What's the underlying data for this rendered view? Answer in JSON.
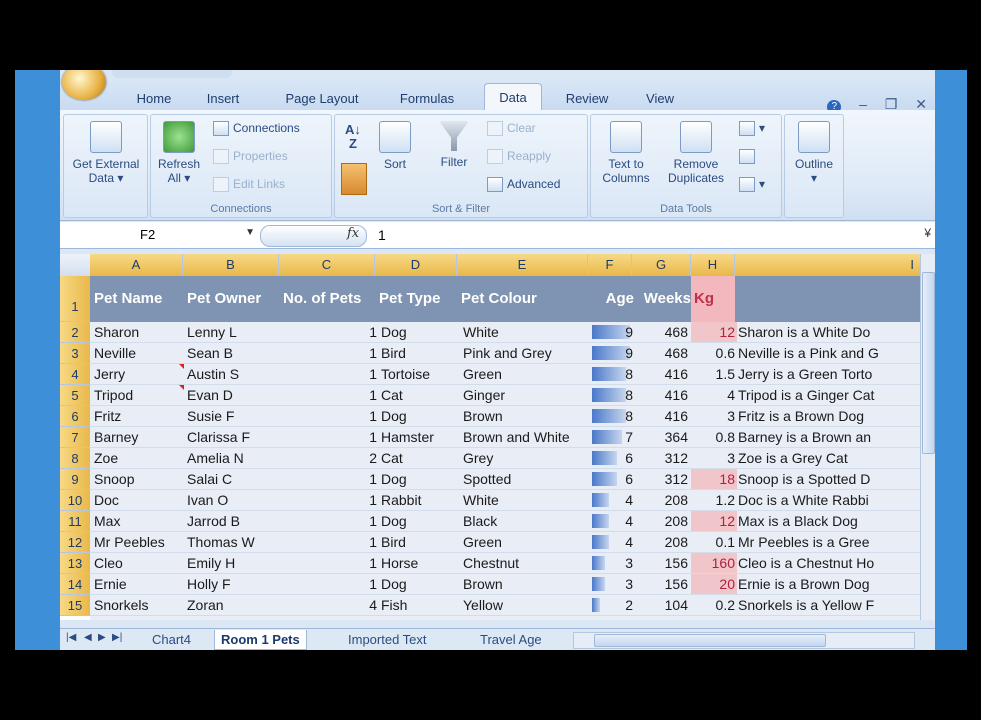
{
  "ribbon": {
    "tabs": [
      "Home",
      "Insert",
      "Page Layout",
      "Formulas",
      "Data",
      "Review",
      "View"
    ],
    "active_tab": "Data",
    "get_external_data": {
      "line1": "Get External",
      "line2": "Data ▾"
    },
    "refresh_all": {
      "line1": "Refresh",
      "line2": "All ▾"
    },
    "connections": "Connections",
    "properties": "Properties",
    "edit_links": "Edit Links",
    "connections_group": "Connections",
    "sort": "Sort",
    "filter": "Filter",
    "clear": "Clear",
    "reapply": "Reapply",
    "advanced": "Advanced",
    "sort_filter_group": "Sort & Filter",
    "text_to_columns": {
      "line1": "Text to",
      "line2": "Columns"
    },
    "remove_duplicates": {
      "line1": "Remove",
      "line2": "Duplicates"
    },
    "data_tools_group": "Data Tools",
    "outline": "Outline"
  },
  "formula_bar": {
    "name_box": "F2",
    "fx": "fx",
    "value": "1"
  },
  "columns": [
    "A",
    "B",
    "C",
    "D",
    "E",
    "F",
    "G",
    "H",
    "I"
  ],
  "headers": {
    "pet_name": "Pet Name",
    "pet_owner": "Pet Owner",
    "num_pets": "No. of Pets",
    "pet_type": "Pet Type",
    "pet_colour": "Pet Colour",
    "age": "Age",
    "weeks": "Weeks",
    "kg": "Kg"
  },
  "rows": [
    {
      "row": "2",
      "name": "Sharon",
      "owner": "Lenny L",
      "num": "1",
      "type": "Dog",
      "colour": "White",
      "age": "9",
      "weeks": "468",
      "kg": "12",
      "desc": "Sharon is a White Do",
      "hi": true
    },
    {
      "row": "3",
      "name": "Neville",
      "owner": "Sean B",
      "num": "1",
      "type": "Bird",
      "colour": "Pink and Grey",
      "age": "9",
      "weeks": "468",
      "kg": "0.6",
      "desc": "Neville is a Pink and G",
      "hi": false
    },
    {
      "row": "4",
      "name": "Jerry",
      "owner": "Austin S",
      "num": "1",
      "type": "Tortoise",
      "colour": "Green",
      "age": "8",
      "weeks": "416",
      "kg": "1.5",
      "desc": "Jerry is a Green Torto",
      "hi": false
    },
    {
      "row": "5",
      "name": "Tripod",
      "owner": "Evan D",
      "num": "1",
      "type": "Cat",
      "colour": "Ginger",
      "age": "8",
      "weeks": "416",
      "kg": "4",
      "desc": "Tripod is a Ginger Cat",
      "hi": false
    },
    {
      "row": "6",
      "name": "Fritz",
      "owner": "Susie F",
      "num": "1",
      "type": "Dog",
      "colour": "Brown",
      "age": "8",
      "weeks": "416",
      "kg": "3",
      "desc": "Fritz is a Brown Dog",
      "hi": false
    },
    {
      "row": "7",
      "name": "Barney",
      "owner": "Clarissa F",
      "num": "1",
      "type": "Hamster",
      "colour": "Brown and White",
      "age": "7",
      "weeks": "364",
      "kg": "0.8",
      "desc": "Barney is a Brown an",
      "hi": false
    },
    {
      "row": "8",
      "name": "Zoe",
      "owner": "Amelia N",
      "num": "2",
      "type": "Cat",
      "colour": "Grey",
      "age": "6",
      "weeks": "312",
      "kg": "3",
      "desc": "Zoe is a Grey Cat",
      "hi": false
    },
    {
      "row": "9",
      "name": "Snoop",
      "owner": "Salai C",
      "num": "1",
      "type": "Dog",
      "colour": "Spotted",
      "age": "6",
      "weeks": "312",
      "kg": "18",
      "desc": "Snoop is a Spotted D",
      "hi": true
    },
    {
      "row": "10",
      "name": "Doc",
      "owner": "Ivan O",
      "num": "1",
      "type": "Rabbit",
      "colour": "White",
      "age": "4",
      "weeks": "208",
      "kg": "1.2",
      "desc": "Doc is a White Rabbi",
      "hi": false
    },
    {
      "row": "11",
      "name": "Max",
      "owner": "Jarrod B",
      "num": "1",
      "type": "Dog",
      "colour": "Black",
      "age": "4",
      "weeks": "208",
      "kg": "12",
      "desc": "Max is a Black Dog",
      "hi": true
    },
    {
      "row": "12",
      "name": "Mr Peebles",
      "owner": "Thomas W",
      "num": "1",
      "type": "Bird",
      "colour": "Green",
      "age": "4",
      "weeks": "208",
      "kg": "0.1",
      "desc": "Mr Peebles is a Gree",
      "hi": false
    },
    {
      "row": "13",
      "name": "Cleo",
      "owner": "Emily H",
      "num": "1",
      "type": "Horse",
      "colour": "Chestnut",
      "age": "3",
      "weeks": "156",
      "kg": "160",
      "desc": "Cleo is a Chestnut Ho",
      "hi": true
    },
    {
      "row": "14",
      "name": "Ernie",
      "owner": "Holly F",
      "num": "1",
      "type": "Dog",
      "colour": "Brown",
      "age": "3",
      "weeks": "156",
      "kg": "20",
      "desc": "Ernie is a Brown Dog",
      "hi": true
    },
    {
      "row": "15",
      "name": "Snorkels",
      "owner": "Zoran",
      "num": "4",
      "type": "Fish",
      "colour": "Yellow",
      "age": "2",
      "weeks": "104",
      "kg": "0.2",
      "desc": "Snorkels is a Yellow F",
      "hi": false
    }
  ],
  "sheet_tabs": [
    "Chart4",
    "Room 1 Pets",
    "Imported Text",
    "Travel Age"
  ],
  "active_sheet": "Room 1 Pets",
  "data_bar_max_age": 9
}
